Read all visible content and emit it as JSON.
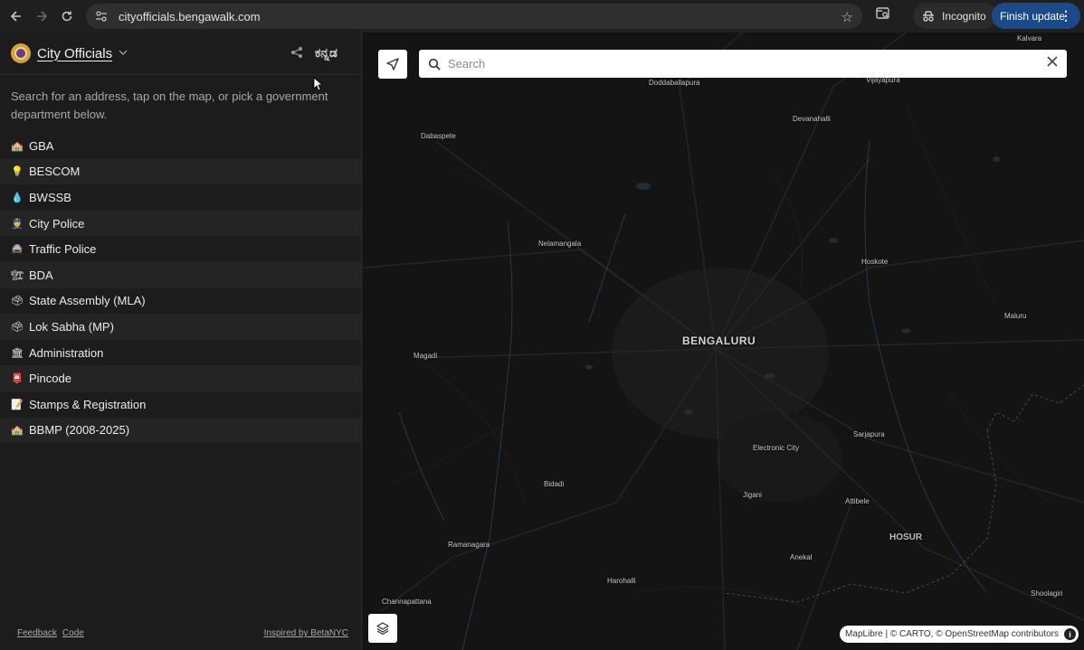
{
  "browser": {
    "url": "cityofficials.bengawalk.com",
    "incognito_label": "Incognito",
    "update_label": "Finish update"
  },
  "sidebar": {
    "title": "City Officials",
    "language_toggle": "ಕನ್ನಡ",
    "intro": "Search for an address, tap on the map, or pick a government department below.",
    "departments": [
      {
        "icon": "🏫",
        "label": "GBA"
      },
      {
        "icon": "💡",
        "label": "BESCOM"
      },
      {
        "icon": "💧",
        "label": "BWSSB"
      },
      {
        "icon": "👮",
        "label": "City Police"
      },
      {
        "icon": "🚔",
        "label": "Traffic Police"
      },
      {
        "icon": "🏗",
        "label": "BDA"
      },
      {
        "icon": "🗳",
        "label": "State Assembly (MLA)"
      },
      {
        "icon": "🗳",
        "label": "Lok Sabha (MP)"
      },
      {
        "icon": "🏛",
        "label": "Administration"
      },
      {
        "icon": "📮",
        "label": "Pincode"
      },
      {
        "icon": "📝",
        "label": "Stamps & Registration"
      },
      {
        "icon": "🏫",
        "label": "BBMP (2008-2025)"
      }
    ],
    "footer": {
      "feedback": "Feedback",
      "code": "Code",
      "inspired": "Inspired by BetaNYC"
    }
  },
  "map": {
    "search_placeholder": "Search",
    "attribution": "MapLibre | © CARTO, © OpenStreetMap contributors",
    "places": {
      "kalvara": "Kalvara",
      "doddaballapura": "Doddaballapura",
      "vijayapura": "Vijayapura",
      "devanahalli": "Devanahalli",
      "dabaspete": "Dabaspete",
      "nelamangala": "Nelamangala",
      "hoskote": "Hoskote",
      "maluru": "Maluru",
      "bengaluru": "BENGALURU",
      "magadi": "Magadi",
      "electronic_city": "Electronic City",
      "sarjapura": "Sarjapura",
      "bidadi": "Bidadi",
      "jigani": "Jigani",
      "attibele": "Attibele",
      "hosur": "HOSUR",
      "ramanagara": "Ramanagara",
      "anekal": "Anekal",
      "harohalli": "Harohalli",
      "channapattana": "Channapattana",
      "shoolagiri": "Shoolagiri"
    }
  }
}
